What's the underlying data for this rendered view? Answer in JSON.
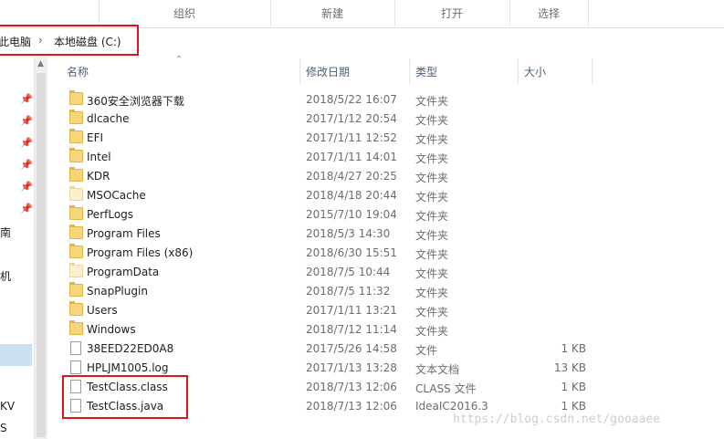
{
  "ribbon": {
    "groups": [
      "组织",
      "新建",
      "打开",
      "选择"
    ]
  },
  "address": {
    "crumbs": [
      "此电脑",
      "本地磁盘 (C:)"
    ]
  },
  "nav": {
    "cut_labels": [
      "南",
      "机",
      "KV",
      "S"
    ]
  },
  "columns": {
    "name": "名称",
    "date": "修改日期",
    "type": "类型",
    "size": "大小"
  },
  "files": [
    {
      "name": "360安全浏览器下载",
      "date": "2018/5/22 16:07",
      "type": "文件夹",
      "size": "",
      "icon": "folder"
    },
    {
      "name": "dlcache",
      "date": "2017/1/12 20:54",
      "type": "文件夹",
      "size": "",
      "icon": "folder"
    },
    {
      "name": "EFI",
      "date": "2017/1/11 12:52",
      "type": "文件夹",
      "size": "",
      "icon": "folder"
    },
    {
      "name": "Intel",
      "date": "2017/1/11 14:01",
      "type": "文件夹",
      "size": "",
      "icon": "folder"
    },
    {
      "name": "KDR",
      "date": "2018/4/27 20:25",
      "type": "文件夹",
      "size": "",
      "icon": "folder"
    },
    {
      "name": "MSOCache",
      "date": "2018/4/18 20:44",
      "type": "文件夹",
      "size": "",
      "icon": "folder-hidden"
    },
    {
      "name": "PerfLogs",
      "date": "2015/7/10 19:04",
      "type": "文件夹",
      "size": "",
      "icon": "folder"
    },
    {
      "name": "Program Files",
      "date": "2018/5/3 14:30",
      "type": "文件夹",
      "size": "",
      "icon": "folder"
    },
    {
      "name": "Program Files (x86)",
      "date": "2018/6/30 15:51",
      "type": "文件夹",
      "size": "",
      "icon": "folder"
    },
    {
      "name": "ProgramData",
      "date": "2018/7/5 10:44",
      "type": "文件夹",
      "size": "",
      "icon": "folder-hidden"
    },
    {
      "name": "SnapPlugin",
      "date": "2018/7/5 11:32",
      "type": "文件夹",
      "size": "",
      "icon": "folder"
    },
    {
      "name": "Users",
      "date": "2017/1/11 13:21",
      "type": "文件夹",
      "size": "",
      "icon": "folder"
    },
    {
      "name": "Windows",
      "date": "2018/7/12 11:14",
      "type": "文件夹",
      "size": "",
      "icon": "folder"
    },
    {
      "name": "38EED22ED0A8",
      "date": "2017/5/26 14:58",
      "type": "文件",
      "size": "1 KB",
      "icon": "file"
    },
    {
      "name": "HPLJM1005.log",
      "date": "2017/1/13 13:28",
      "type": "文本文档",
      "size": "13 KB",
      "icon": "file"
    },
    {
      "name": "TestClass.class",
      "date": "2018/7/13 12:06",
      "type": "CLASS 文件",
      "size": "1 KB",
      "icon": "file"
    },
    {
      "name": "TestClass.java",
      "date": "2018/7/13 12:06",
      "type": "IdeaIC2016.3",
      "size": "1 KB",
      "icon": "file"
    }
  ],
  "watermark": "https://blog.csdn.net/gooaaee",
  "colors": {
    "highlight_border": "#e0131e",
    "folder": "#f6d67a",
    "selection": "#cce0f4"
  }
}
